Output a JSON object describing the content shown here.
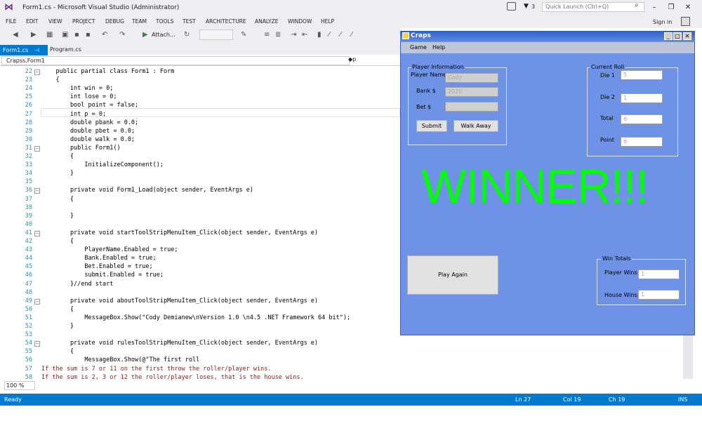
{
  "vs": {
    "title": "Form1.cs - Microsoft Visual Studio (Administrator)",
    "notify_count": "3",
    "quick_launch_placeholder": "Quick Launch (Ctrl+Q)",
    "sign_in": "Sign in",
    "menu": [
      "FILE",
      "EDIT",
      "VIEW",
      "PROJECT",
      "DEBUG",
      "TEAM",
      "TOOLS",
      "TEST",
      "ARCHITECTURE",
      "ANALYZE",
      "WINDOW",
      "HELP"
    ],
    "toolbar": {
      "attach_label": "Attach..."
    },
    "tabs": {
      "active": "Form1.cs",
      "other": "Program.cs"
    },
    "nav": {
      "class_path": "Crapss.Form1",
      "member": "p"
    },
    "zoom": "100 %",
    "status": {
      "ready": "Ready",
      "ln": "Ln 27",
      "col": "Col 19",
      "ch": "Ch 19",
      "ins": "INS"
    }
  },
  "code_lines": [
    {
      "n": "22",
      "t": "    public partial class Form1 : Form"
    },
    {
      "n": "23",
      "t": "    {"
    },
    {
      "n": "24",
      "t": "        int win = 0;"
    },
    {
      "n": "25",
      "t": "        int lose = 0;"
    },
    {
      "n": "26",
      "t": "        bool point = false;"
    },
    {
      "n": "27",
      "t": "        int p = 0;"
    },
    {
      "n": "28",
      "t": "        double pbank = 0.0;"
    },
    {
      "n": "29",
      "t": "        double pbet = 0.0;"
    },
    {
      "n": "30",
      "t": "        double walk = 0.0;"
    },
    {
      "n": "31",
      "t": "        public Form1()"
    },
    {
      "n": "32",
      "t": "        {"
    },
    {
      "n": "33",
      "t": "            InitializeComponent();"
    },
    {
      "n": "34",
      "t": "        }"
    },
    {
      "n": "35",
      "t": ""
    },
    {
      "n": "36",
      "t": "        private void Form1_Load(object sender, EventArgs e)"
    },
    {
      "n": "37",
      "t": "        {"
    },
    {
      "n": "38",
      "t": ""
    },
    {
      "n": "39",
      "t": "        }"
    },
    {
      "n": "40",
      "t": ""
    },
    {
      "n": "41",
      "t": "        private void startToolStripMenuItem_Click(object sender, EventArgs e)"
    },
    {
      "n": "42",
      "t": "        {"
    },
    {
      "n": "43",
      "t": "            PlayerName.Enabled = true;"
    },
    {
      "n": "44",
      "t": "            Bank.Enabled = true;"
    },
    {
      "n": "45",
      "t": "            Bet.Enabled = true;"
    },
    {
      "n": "46",
      "t": "            submit.Enabled = true;"
    },
    {
      "n": "47",
      "t": "        }//end start"
    },
    {
      "n": "48",
      "t": ""
    },
    {
      "n": "49",
      "t": "        private void aboutToolStripMenuItem_Click(object sender, EventArgs e)"
    },
    {
      "n": "50",
      "t": "        {"
    },
    {
      "n": "51",
      "t": "            MessageBox.Show(\"Cody Demianew\\nVersion 1.0 \\n4.5 .NET Framework 64 bit\");"
    },
    {
      "n": "52",
      "t": "        }"
    },
    {
      "n": "53",
      "t": ""
    },
    {
      "n": "54",
      "t": "        private void rulesToolStripMenuItem_Click(object sender, EventArgs e)"
    },
    {
      "n": "55",
      "t": "        {"
    },
    {
      "n": "56",
      "t": "            MessageBox.Show(@\"The first roll"
    },
    {
      "n": "57",
      "t": "If the sum is 7 or 11 on the first throw the roller/player wins."
    },
    {
      "n": "58",
      "t": "If the sum is 2, 3 or 12 the roller/player loses, that is the house wins."
    }
  ],
  "craps": {
    "title": "Craps",
    "menu": {
      "game": "Game",
      "help": "Help"
    },
    "player_info": {
      "group": "Player Information",
      "name_label": "Player Name",
      "name_value": "Cody",
      "bank_label": "Bank $",
      "bank_value": "2020",
      "bet_label": "Bet  $",
      "bet_value": "",
      "submit": "Submit",
      "walk_away": "Walk Away"
    },
    "current_roll": {
      "group": "Current Roll",
      "die1_label": "Die 1",
      "die1_value": "5",
      "die2_label": "Die 2",
      "die2_value": "1",
      "total_label": "Total",
      "total_value": "6",
      "point_label": "Point",
      "point_value": "6"
    },
    "winner": "WINNER!!!",
    "play_again": "Play Again",
    "win_totals": {
      "group": "Win Totals",
      "player_label": "Player Wins",
      "player_value": "1",
      "house_label": "House Wins",
      "house_value": "1"
    }
  },
  "colors": {
    "status_bar": "#007acc",
    "form_bg": "#6d92e6",
    "winner_text": "#00ff00"
  }
}
